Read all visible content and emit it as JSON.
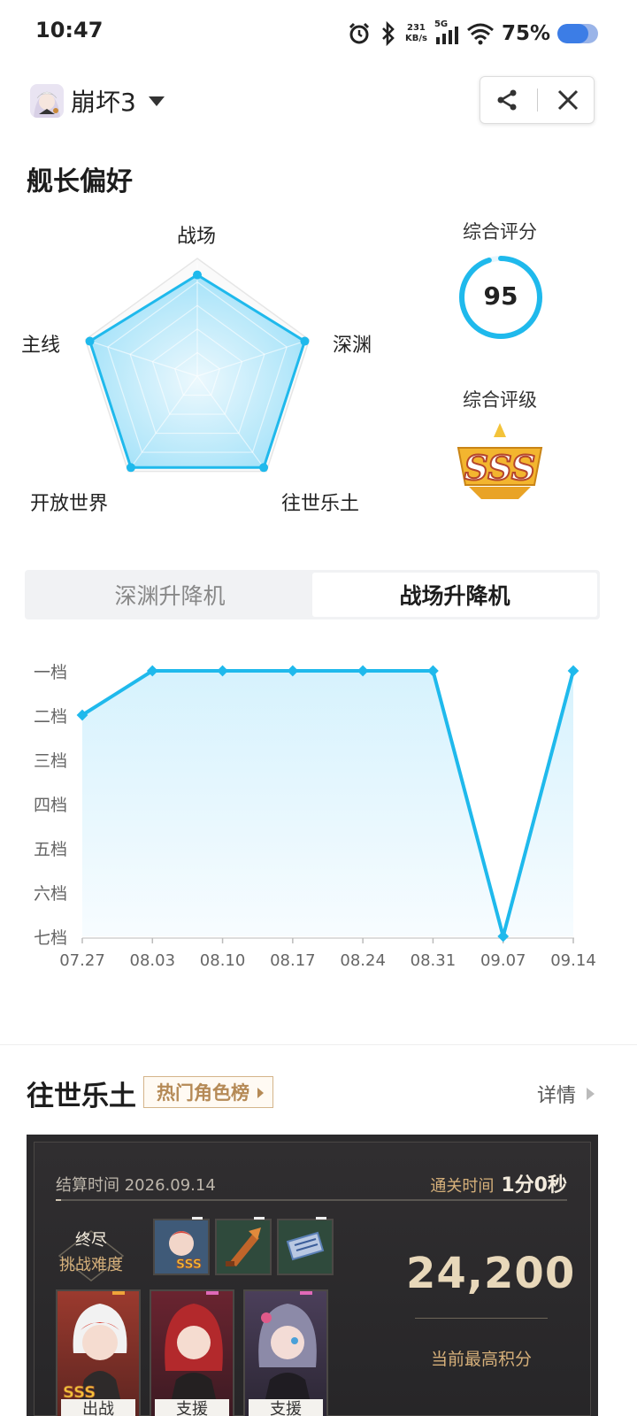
{
  "status_bar": {
    "time": "10:47",
    "net_speed": "231",
    "net_unit": "KB/s",
    "signal": "5G",
    "battery": "75%",
    "battery_level": 0.75
  },
  "header": {
    "game_name": "崩坏3"
  },
  "preference": {
    "title": "舰长偏好",
    "radar_labels": [
      "战场",
      "深渊",
      "往世乐土",
      "开放世界",
      "主线"
    ],
    "radar_values": [
      0.86,
      0.96,
      0.96,
      0.96,
      0.96
    ],
    "score_label": "综合评分",
    "score": "95",
    "grade_label": "综合评级",
    "grade": "SSS",
    "colors": {
      "accent": "#1fb9ec",
      "fill": "#bfe9fb"
    }
  },
  "tabs": [
    {
      "label": "深渊升降机",
      "active": false
    },
    {
      "label": "战场升降机",
      "active": true
    }
  ],
  "chart_data": {
    "type": "area",
    "title": "",
    "xlabel": "",
    "ylabel": "",
    "x": [
      "07.27",
      "08.03",
      "08.10",
      "08.17",
      "08.24",
      "08.31",
      "09.07",
      "09.14"
    ],
    "y_categories": [
      "一档",
      "二档",
      "三档",
      "四档",
      "五档",
      "六档",
      "七档"
    ],
    "values": [
      "二档",
      "一档",
      "一档",
      "一档",
      "一档",
      "一档",
      "七档",
      "一档"
    ],
    "grid": false,
    "color": "#1fb9ec"
  },
  "section2": {
    "title": "往世乐土",
    "hot_button": "热门角色榜",
    "detail": "详情",
    "card": {
      "settle_text": "结算时间 2026.09.14",
      "clear_label": "通关时间",
      "clear_value": "1分0秒",
      "difficulty_name": "终尽",
      "difficulty_label": "挑战难度",
      "score": "24,200",
      "score_caption": "当前最高积分",
      "characters": [
        {
          "tag": "出战"
        },
        {
          "tag": "支援"
        },
        {
          "tag": "支援"
        }
      ]
    }
  }
}
